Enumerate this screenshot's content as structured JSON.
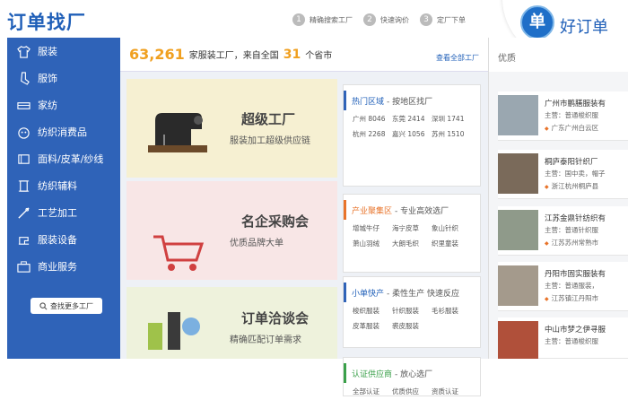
{
  "header": {
    "logo": "订单找厂",
    "steps": [
      {
        "num": "1",
        "label": "精确搜索工厂"
      },
      {
        "num": "2",
        "label": "快速询价"
      },
      {
        "num": "3",
        "label": "定厂下单"
      }
    ],
    "brand_icon_char": "单",
    "brand_name": "好订单"
  },
  "sidebar": {
    "items": [
      {
        "label": "服装",
        "icon": "shirt-icon"
      },
      {
        "label": "服饰",
        "icon": "sock-icon"
      },
      {
        "label": "家纺",
        "icon": "bedding-icon"
      },
      {
        "label": "纺织消费品",
        "icon": "cart-bag-icon"
      },
      {
        "label": "面料/皮革/纱线",
        "icon": "fabric-roll-icon"
      },
      {
        "label": "纺织辅料",
        "icon": "spool-icon"
      },
      {
        "label": "工艺加工",
        "icon": "needle-icon"
      },
      {
        "label": "服装设备",
        "icon": "sewing-machine-icon"
      },
      {
        "label": "商业服务",
        "icon": "briefcase-icon"
      }
    ],
    "more_button": "查找更多工厂"
  },
  "stats": {
    "factory_count": "63,261",
    "text1": "家服装工厂，来自全国",
    "province_count": "31",
    "text2": "个省市",
    "view_all": "查看全部工厂"
  },
  "banners": [
    {
      "title": "超级工厂",
      "subtitle": "服装加工超级供应链"
    },
    {
      "title": "名企采购会",
      "subtitle": "优质品牌大单"
    },
    {
      "title": "订单洽谈会",
      "subtitle": "精确匹配订单需求"
    }
  ],
  "panels": [
    {
      "highlight": "热门区域",
      "sub": "- 按地区找厂",
      "items": [
        "广州 8046",
        "东莞 2414",
        "深圳 1741",
        "杭州 2268",
        "嘉兴 1056",
        "苏州 1510"
      ]
    },
    {
      "highlight": "产业聚集区",
      "sub": "- 专业高效选厂",
      "items": [
        "增城牛仔",
        "海宁皮草",
        "象山针织",
        "萧山羽绒",
        "大朗毛织",
        "织里童装"
      ]
    },
    {
      "highlight": "小单快产",
      "sub": "- 柔性生产 快速反应",
      "items": [
        "梭织服装",
        "针织服装",
        "毛衫服装",
        "皮革服装",
        "裘皮服装",
        ""
      ]
    },
    {
      "highlight": "认证供应商",
      "sub": "- 放心选厂",
      "items": [
        "全部认证",
        "优质供应",
        "资质认证"
      ]
    }
  ],
  "right": {
    "title": "优质",
    "cards": [
      {
        "name": "广州市鹏膳服装有",
        "main_prod": "主营：普通梭织服",
        "loc": "广东广州白云区"
      },
      {
        "name": "桐庐泰阳针织厂",
        "main_prod": "主营：国中卖，帽子",
        "loc": "浙江杭州桐庐县"
      },
      {
        "name": "江苏金鼎针纺织有",
        "main_prod": "主营：普通针织服",
        "loc": "江苏苏州常熟市"
      },
      {
        "name": "丹阳市固实服装有",
        "main_prod": "主营：普通服装，",
        "loc": "江苏镇江丹阳市"
      },
      {
        "name": "中山市梦之伊寻服",
        "main_prod": "主营：普通梭织服",
        "loc": ""
      }
    ]
  },
  "colors": {
    "brand_blue": "#2f63b8",
    "accent_orange": "#f0a020",
    "green": "#3aa04a"
  }
}
